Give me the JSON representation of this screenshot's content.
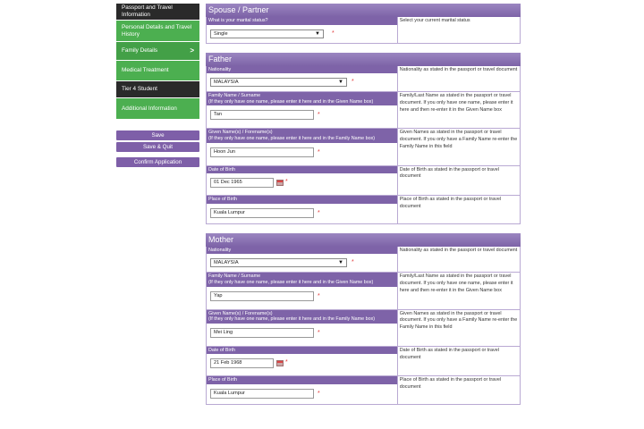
{
  "sidebar": {
    "items": [
      {
        "label": "Passport and Travel Information",
        "style": "dark"
      },
      {
        "label": "Personal Details and Travel History",
        "style": "green"
      },
      {
        "label": "Family Details",
        "style": "active",
        "arrow": ">"
      },
      {
        "label": "Medical Treatment",
        "style": "green"
      },
      {
        "label": "Tier 4 Student",
        "style": "dark"
      },
      {
        "label": "Additional Information",
        "style": "green"
      }
    ],
    "save_label": "Save",
    "save_quit_label": "Save & Quit",
    "confirm_label": "Confirm Application"
  },
  "spouse": {
    "title": "Spouse / Partner",
    "marital_label": "What is your marital status?",
    "marital_value": "Single",
    "marital_help": "Select your current marital status"
  },
  "father": {
    "title": "Father",
    "nationality_label": "Nationality",
    "nationality_value": "MALAYSIA",
    "nationality_help": "Nationality as stated in the passport or travel document",
    "family_name_label": "Family Name / Surname\n(If they only have one name, please enter it here and in the Given Name box)",
    "family_name_value": "Tan",
    "family_name_help": "Family/Last Name as stated in the passport or travel document. If you only have one name, please enter it here and then re-enter it in the Given Name box",
    "given_name_label": "Given Name(s) / Forename(s)\n(If they only have one name, please enter it here and in the Family Name box)",
    "given_name_value": "Hoon Jun",
    "given_name_help": "Given Names as stated in the passport or travel document. If you only have a Family Name re-enter the Family Name in this field",
    "dob_label": "Date of Birth",
    "dob_value": "01 Dec 1965",
    "dob_help": "Date of Birth as stated in the passport or travel document",
    "pob_label": "Place of Birth",
    "pob_value": "Kuala Lumpur",
    "pob_help": "Place of Birth as stated in the passport or travel document"
  },
  "mother": {
    "title": "Mother",
    "nationality_label": "Nationality",
    "nationality_value": "MALAYSIA",
    "nationality_help": "Nationality as stated in the passport or travel document",
    "family_name_label": "Family Name / Surname\n(If they only have one name, please enter it here and in the Given Name box)",
    "family_name_value": "Yap",
    "family_name_help": "Family/Last Name as stated in the passport or travel document. If you only have one name, please enter it here and then re-enter it in the Given Name box",
    "given_name_label": "Given Name(s) / Forename(s)\n(If they only have one name, please enter it here and in the Family Name box)",
    "given_name_value": "Mei Ling",
    "given_name_help": "Given Names as stated in the passport or travel document. If you only have a Family Name re-enter the Family Name in this field",
    "dob_label": "Date of Birth",
    "dob_value": "21 Feb 1968",
    "dob_help": "Date of Birth as stated in the passport or travel document",
    "pob_label": "Place of Birth",
    "pob_value": "Kuala Lumpur",
    "pob_help": "Place of Birth as stated in the passport or travel document"
  },
  "common": {
    "required_mark": "*",
    "caret": "▼"
  },
  "colors": {
    "accent_purple": "#7e63a8",
    "nav_green": "#4caf50",
    "nav_dark": "#2a2a2a",
    "required_red": "#e23b3b"
  },
  "icons": {
    "calendar": "calendar-icon",
    "dropdown": "chevron-down-icon"
  }
}
